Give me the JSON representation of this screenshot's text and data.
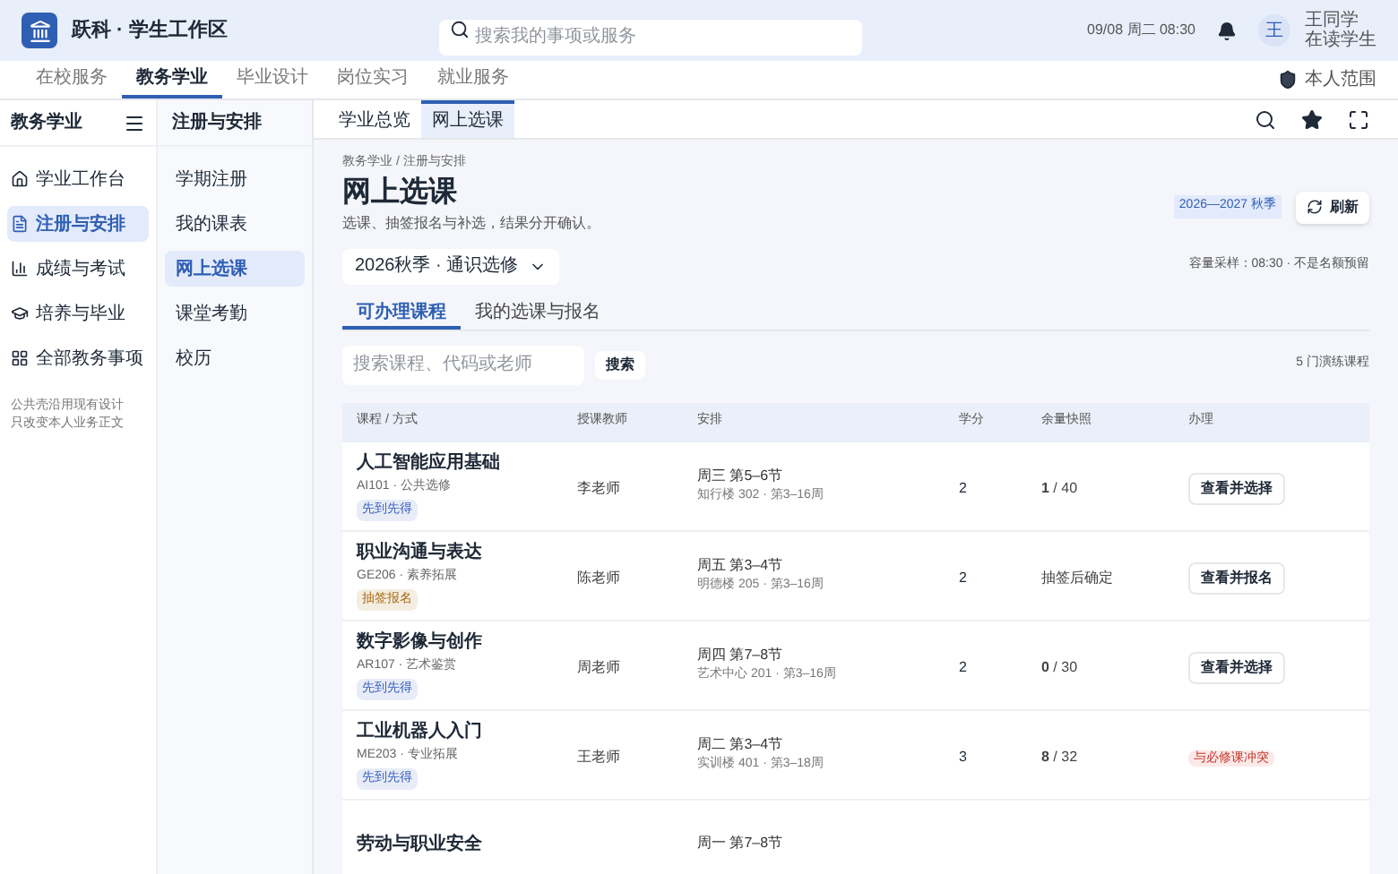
{
  "app": {
    "title": "跃科 · 学生工作区",
    "search_placeholder": "搜索我的事项或服务",
    "datetime": "09/08 周二 08:30",
    "user": {
      "avatar": "王",
      "name": "王同学",
      "role": "在读学生"
    }
  },
  "nav_tabs": [
    {
      "label": "在校服务",
      "selected": false
    },
    {
      "label": "教务学业",
      "selected": true
    },
    {
      "label": "毕业设计",
      "selected": false
    },
    {
      "label": "岗位实习",
      "selected": false
    },
    {
      "label": "就业服务",
      "selected": false
    }
  ],
  "scope": "本人范围",
  "sidebar": {
    "title": "教务学业",
    "items": [
      {
        "label": "学业工作台",
        "selected": false
      },
      {
        "label": "注册与安排",
        "selected": true
      },
      {
        "label": "成绩与考试",
        "selected": false
      },
      {
        "label": "培养与毕业",
        "selected": false
      },
      {
        "label": "全部教务事项",
        "selected": false
      }
    ],
    "notes": [
      "公共壳沿用现有设计",
      "只改变本人业务正文"
    ]
  },
  "subnav": {
    "title": "注册与安排",
    "items": [
      {
        "label": "学期注册",
        "selected": false
      },
      {
        "label": "我的课表",
        "selected": false
      },
      {
        "label": "网上选课",
        "selected": true
      },
      {
        "label": "课堂考勤",
        "selected": false
      },
      {
        "label": "校历",
        "selected": false
      }
    ]
  },
  "page_tabs": [
    {
      "label": "学业总览",
      "selected": false
    },
    {
      "label": "网上选课",
      "selected": true
    }
  ],
  "breadcrumb": "教务学业 / 注册与安排",
  "title": "网上选课",
  "subtitle": "选课、抽签报名与补选，结果分开确认。",
  "term_badge": "2026—2027 秋季",
  "refresh": "刷新",
  "term_select": "2026秋季 · 通识选修",
  "capacity_note": "容量采样：08:30 · 不是名额预留",
  "content_tabs": [
    {
      "label": "可办理课程",
      "selected": true
    },
    {
      "label": "我的选课与报名",
      "selected": false
    }
  ],
  "course_search": {
    "placeholder": "搜索课程、代码或老师",
    "button": "搜索"
  },
  "course_count": "5 门演练课程",
  "table": {
    "columns": [
      "课程 / 方式",
      "授课教师",
      "安排",
      "学分",
      "余量快照",
      "办理"
    ],
    "rows": [
      {
        "name": "人工智能应用基础",
        "code": "AI101 · 公共选修",
        "tag": {
          "label": "先到先得",
          "color": "#3b5fc0"
        },
        "teacher": "李老师",
        "time": "周三 第5–6节",
        "place": "知行楼 302 · 第3–16周",
        "credits": "2",
        "quota": "**1** / 40",
        "action": {
          "kind": "button",
          "label": "查看并选择"
        }
      },
      {
        "name": "职业沟通与表达",
        "code": "GE206 · 素养拓展",
        "tag": {
          "label": "抽签报名",
          "color": "#a86a12"
        },
        "teacher": "陈老师",
        "time": "周五 第3–4节",
        "place": "明德楼 205 · 第3–16周",
        "credits": "2",
        "quota": "抽签后确定",
        "action": {
          "kind": "button",
          "label": "查看并报名"
        }
      },
      {
        "name": "数字影像与创作",
        "code": "AR107 · 艺术鉴赏",
        "tag": {
          "label": "先到先得",
          "color": "#3b5fc0"
        },
        "teacher": "周老师",
        "time": "周四 第7–8节",
        "place": "艺术中心 201 · 第3–16周",
        "credits": "2",
        "quota": "**0** / 30",
        "action": {
          "kind": "button",
          "label": "查看并选择"
        }
      },
      {
        "name": "工业机器人入门",
        "code": "ME203 · 专业拓展",
        "tag": {
          "label": "先到先得",
          "color": "#3b5fc0"
        },
        "teacher": "王老师",
        "time": "周二 第3–4节",
        "place": "实训楼 401 · 第3–18周",
        "credits": "3",
        "quota": "**8** / 32",
        "action": {
          "kind": "warning",
          "label": "与必修课冲突"
        }
      },
      {
        "name": "劳动与职业安全",
        "time": "周一 第7–8节"
      }
    ]
  }
}
